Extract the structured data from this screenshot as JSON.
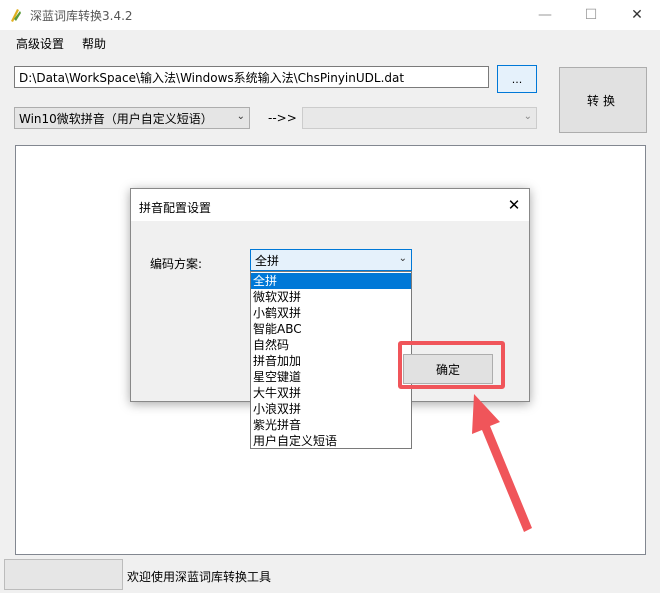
{
  "window": {
    "title": "深蓝词库转换3.4.2",
    "controls": {
      "minimize": "—",
      "maximize": "☐",
      "close": "✕"
    }
  },
  "menu": {
    "items": [
      "高级设置",
      "帮助"
    ]
  },
  "file": {
    "path": "D:\\Data\\WorkSpace\\输入法\\Windows系统输入法\\ChsPinyinUDL.dat",
    "browse_label": "..."
  },
  "convert": {
    "label": "转换"
  },
  "formats": {
    "source": "Win10微软拼音（用户自定义短语）",
    "arrow": "-->>",
    "target": ""
  },
  "status": {
    "message": "欢迎使用深蓝词库转换工具"
  },
  "dialog": {
    "title": "拼音配置设置",
    "close": "✕",
    "scheme_label": "编码方案:",
    "scheme_value": "全拼",
    "options": [
      "全拼",
      "微软双拼",
      "小鹤双拼",
      "智能ABC",
      "自然码",
      "拼音加加",
      "星空键道",
      "大牛双拼",
      "小浪双拼",
      "紫光拼音",
      "用户自定义短语"
    ],
    "ok_label": "确定"
  },
  "colors": {
    "accent": "#0078d7",
    "annotation": "#f0555a"
  }
}
